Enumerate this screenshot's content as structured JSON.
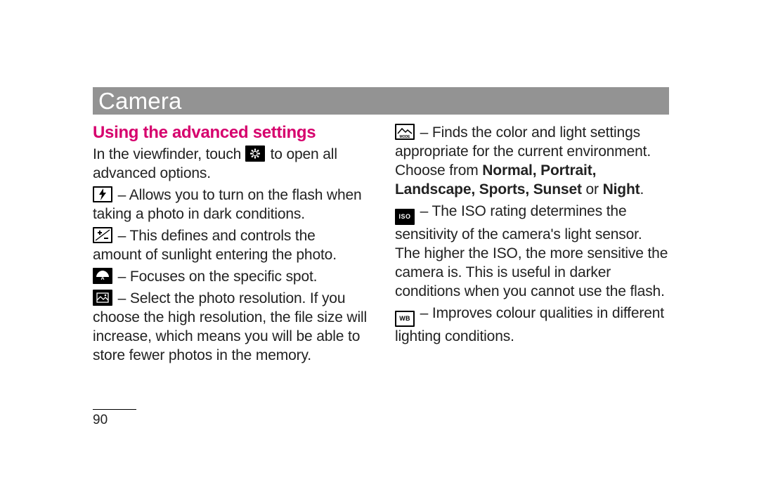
{
  "titlebar": "Camera",
  "subhead": "Using the advanced settings",
  "left": {
    "intro_a": "In the viewfinder, touch ",
    "intro_b": " to open all advanced options.",
    "flash": " – Allows you to turn on the flash when taking a photo in dark conditions.",
    "exposure": " – This defines and controls the amount of sunlight entering the photo.",
    "focus": " – Focuses on the specific spot.",
    "resolution": " – Select the photo resolution. If you choose the high resolution, the file size will increase, which means you will be able to store fewer photos in the memory."
  },
  "right": {
    "mode_a": " – Finds the color and light settings appropriate for the current environment. Choose from ",
    "mode_list": "Normal, Portrait, Landscape, Sports, Sunset",
    "mode_or": " or ",
    "mode_last": "Night",
    "mode_end": ".",
    "iso": " – The ISO rating determines the sensitivity of the camera's light sensor. The higher the ISO, the more sensitive the camera is. This is useful in darker conditions when you cannot use the flash.",
    "wb": " – Improves colour qualities in different lighting conditions."
  },
  "icon_labels": {
    "iso": "ISO",
    "wb": "WB",
    "mode": "MODE"
  },
  "page_number": "90"
}
